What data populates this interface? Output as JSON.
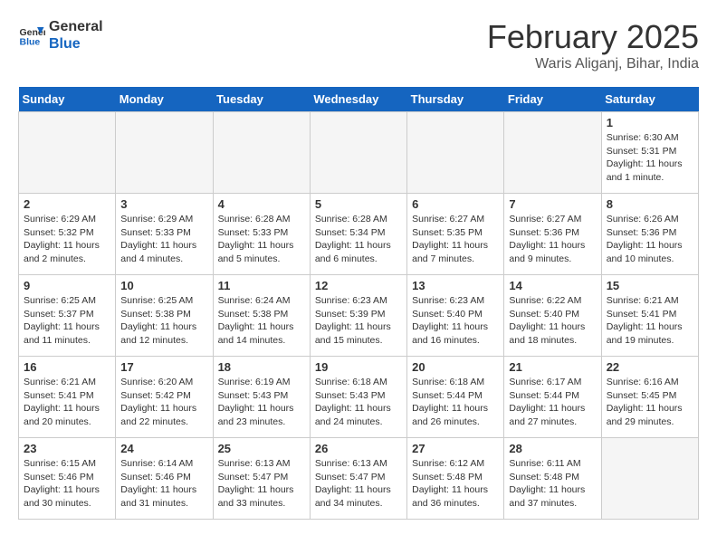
{
  "logo": {
    "line1": "General",
    "line2": "Blue"
  },
  "title": "February 2025",
  "location": "Waris Aliganj, Bihar, India",
  "days_of_week": [
    "Sunday",
    "Monday",
    "Tuesday",
    "Wednesday",
    "Thursday",
    "Friday",
    "Saturday"
  ],
  "weeks": [
    [
      {
        "day": "",
        "info": ""
      },
      {
        "day": "",
        "info": ""
      },
      {
        "day": "",
        "info": ""
      },
      {
        "day": "",
        "info": ""
      },
      {
        "day": "",
        "info": ""
      },
      {
        "day": "",
        "info": ""
      },
      {
        "day": "1",
        "info": "Sunrise: 6:30 AM\nSunset: 5:31 PM\nDaylight: 11 hours\nand 1 minute."
      }
    ],
    [
      {
        "day": "2",
        "info": "Sunrise: 6:29 AM\nSunset: 5:32 PM\nDaylight: 11 hours\nand 2 minutes."
      },
      {
        "day": "3",
        "info": "Sunrise: 6:29 AM\nSunset: 5:33 PM\nDaylight: 11 hours\nand 4 minutes."
      },
      {
        "day": "4",
        "info": "Sunrise: 6:28 AM\nSunset: 5:33 PM\nDaylight: 11 hours\nand 5 minutes."
      },
      {
        "day": "5",
        "info": "Sunrise: 6:28 AM\nSunset: 5:34 PM\nDaylight: 11 hours\nand 6 minutes."
      },
      {
        "day": "6",
        "info": "Sunrise: 6:27 AM\nSunset: 5:35 PM\nDaylight: 11 hours\nand 7 minutes."
      },
      {
        "day": "7",
        "info": "Sunrise: 6:27 AM\nSunset: 5:36 PM\nDaylight: 11 hours\nand 9 minutes."
      },
      {
        "day": "8",
        "info": "Sunrise: 6:26 AM\nSunset: 5:36 PM\nDaylight: 11 hours\nand 10 minutes."
      }
    ],
    [
      {
        "day": "9",
        "info": "Sunrise: 6:25 AM\nSunset: 5:37 PM\nDaylight: 11 hours\nand 11 minutes."
      },
      {
        "day": "10",
        "info": "Sunrise: 6:25 AM\nSunset: 5:38 PM\nDaylight: 11 hours\nand 12 minutes."
      },
      {
        "day": "11",
        "info": "Sunrise: 6:24 AM\nSunset: 5:38 PM\nDaylight: 11 hours\nand 14 minutes."
      },
      {
        "day": "12",
        "info": "Sunrise: 6:23 AM\nSunset: 5:39 PM\nDaylight: 11 hours\nand 15 minutes."
      },
      {
        "day": "13",
        "info": "Sunrise: 6:23 AM\nSunset: 5:40 PM\nDaylight: 11 hours\nand 16 minutes."
      },
      {
        "day": "14",
        "info": "Sunrise: 6:22 AM\nSunset: 5:40 PM\nDaylight: 11 hours\nand 18 minutes."
      },
      {
        "day": "15",
        "info": "Sunrise: 6:21 AM\nSunset: 5:41 PM\nDaylight: 11 hours\nand 19 minutes."
      }
    ],
    [
      {
        "day": "16",
        "info": "Sunrise: 6:21 AM\nSunset: 5:41 PM\nDaylight: 11 hours\nand 20 minutes."
      },
      {
        "day": "17",
        "info": "Sunrise: 6:20 AM\nSunset: 5:42 PM\nDaylight: 11 hours\nand 22 minutes."
      },
      {
        "day": "18",
        "info": "Sunrise: 6:19 AM\nSunset: 5:43 PM\nDaylight: 11 hours\nand 23 minutes."
      },
      {
        "day": "19",
        "info": "Sunrise: 6:18 AM\nSunset: 5:43 PM\nDaylight: 11 hours\nand 24 minutes."
      },
      {
        "day": "20",
        "info": "Sunrise: 6:18 AM\nSunset: 5:44 PM\nDaylight: 11 hours\nand 26 minutes."
      },
      {
        "day": "21",
        "info": "Sunrise: 6:17 AM\nSunset: 5:44 PM\nDaylight: 11 hours\nand 27 minutes."
      },
      {
        "day": "22",
        "info": "Sunrise: 6:16 AM\nSunset: 5:45 PM\nDaylight: 11 hours\nand 29 minutes."
      }
    ],
    [
      {
        "day": "23",
        "info": "Sunrise: 6:15 AM\nSunset: 5:46 PM\nDaylight: 11 hours\nand 30 minutes."
      },
      {
        "day": "24",
        "info": "Sunrise: 6:14 AM\nSunset: 5:46 PM\nDaylight: 11 hours\nand 31 minutes."
      },
      {
        "day": "25",
        "info": "Sunrise: 6:13 AM\nSunset: 5:47 PM\nDaylight: 11 hours\nand 33 minutes."
      },
      {
        "day": "26",
        "info": "Sunrise: 6:13 AM\nSunset: 5:47 PM\nDaylight: 11 hours\nand 34 minutes."
      },
      {
        "day": "27",
        "info": "Sunrise: 6:12 AM\nSunset: 5:48 PM\nDaylight: 11 hours\nand 36 minutes."
      },
      {
        "day": "28",
        "info": "Sunrise: 6:11 AM\nSunset: 5:48 PM\nDaylight: 11 hours\nand 37 minutes."
      },
      {
        "day": "",
        "info": ""
      }
    ]
  ]
}
